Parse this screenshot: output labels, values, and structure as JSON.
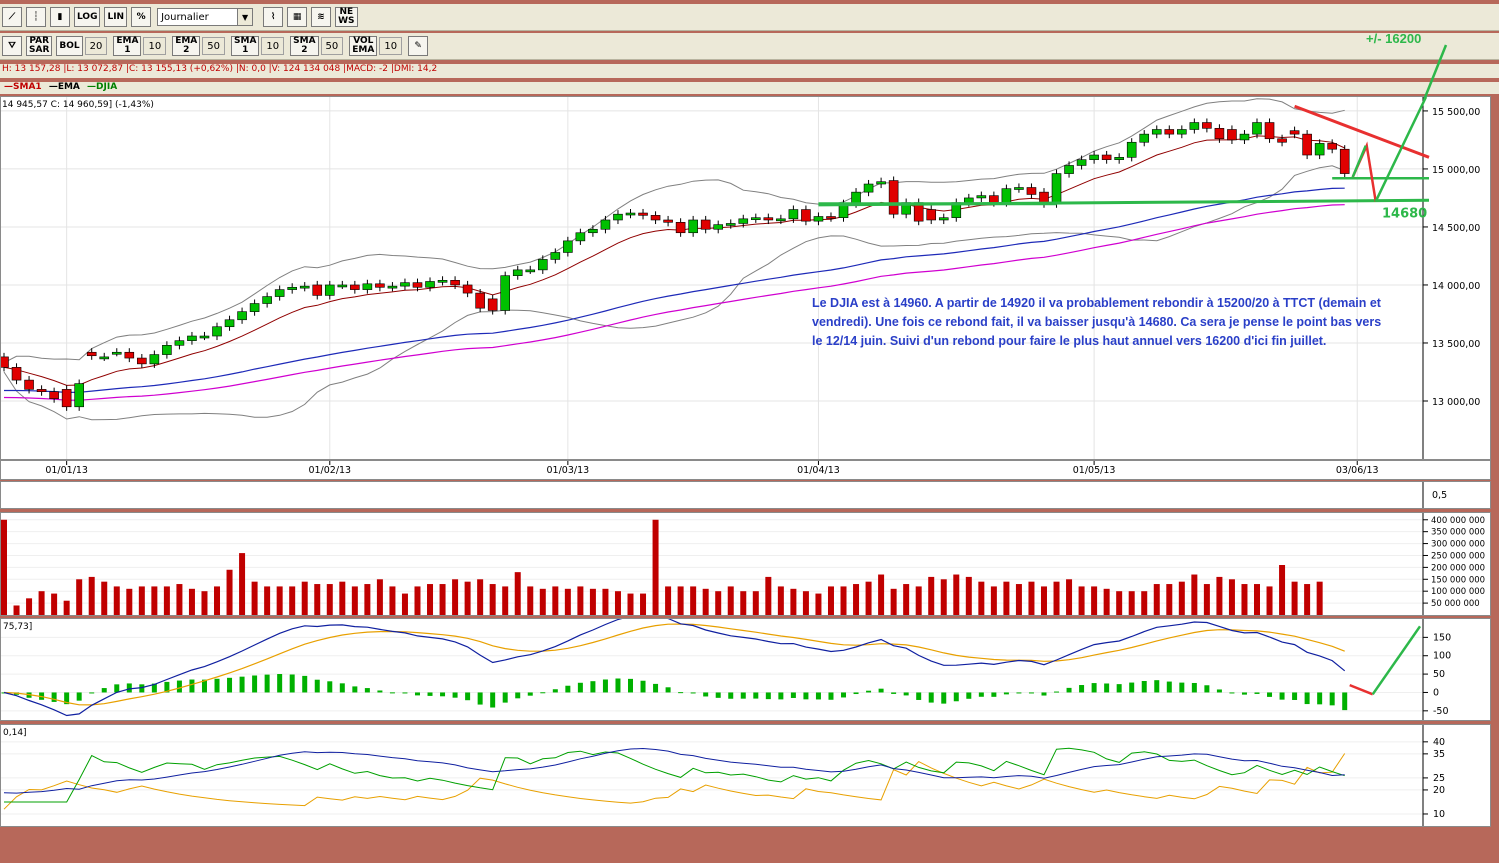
{
  "toolbar1": {
    "buttons": [
      {
        "name": "line-chart-icon",
        "label": ""
      },
      {
        "name": "bar-chart-icon",
        "label": ""
      },
      {
        "name": "candle-chart-icon",
        "label": ""
      },
      {
        "name": "log-button",
        "label": "LOG"
      },
      {
        "name": "lin-button",
        "label": "LIN"
      },
      {
        "name": "percent-button",
        "label": "%"
      }
    ],
    "period_select": "Journalier",
    "tools": [
      {
        "name": "studies-icon",
        "label": ""
      },
      {
        "name": "palette-icon",
        "label": ""
      },
      {
        "name": "compare-icon",
        "label": ""
      },
      {
        "name": "news-button",
        "label": "NE\nWS"
      }
    ]
  },
  "toolbar2": {
    "items": [
      {
        "name": "trash-icon",
        "label": "",
        "value": ""
      },
      {
        "name": "parsar-button",
        "label": "PAR\nSAR",
        "value": ""
      },
      {
        "name": "bol-button",
        "label": "BOL",
        "value": "20"
      },
      {
        "name": "ema1-button",
        "label": "EMA\n1",
        "value": "10"
      },
      {
        "name": "ema2-button",
        "label": "EMA\n2",
        "value": "50"
      },
      {
        "name": "sma1-button",
        "label": "SMA\n1",
        "value": "10"
      },
      {
        "name": "sma2-button",
        "label": "SMA\n2",
        "value": "50"
      },
      {
        "name": "volema-button",
        "label": "VOL\nEMA",
        "value": "10"
      },
      {
        "name": "drawing-icon",
        "label": "",
        "value": ""
      }
    ]
  },
  "infobar": "H: 13 157,28 |L: 13 072,87 |C: 13 155,13 (+0,62%) |N: 0,0 |V: 124 134 048 |MACD: -2 |DMI: 14,2",
  "legend": {
    "items": [
      {
        "label": "SMA1",
        "color": "#c00000"
      },
      {
        "label": "EMA",
        "color": "#000080"
      },
      {
        "label": "DJIA",
        "color": "#008000"
      }
    ],
    "sub": "14 945,57  C: 14 960,59] (-1,43%)"
  },
  "colors": {
    "up_candle": "#00c000",
    "down_candle": "#e00000",
    "bollinger": "#808080",
    "sma": "#900000",
    "ema_blue": "#1e2ab8",
    "ema_magenta": "#d000d0",
    "annotation_green": "#2db84a",
    "annotation_red": "#e83030",
    "annotation_text": "#2a3fc8",
    "volume": "#c00000",
    "macd_line": "#1020a0",
    "macd_signal": "#e8a000",
    "macd_hist": "#00b000",
    "dmi_blue": "#1020a0",
    "dmi_green": "#00a000",
    "dmi_orange": "#e8a000"
  },
  "annotation": {
    "text": "Le DJIA est à 14960. A partir de 14920 il va probablement rebondir à 15200/20 à TTCT (demain et vendredi). Une fois ce rebond fait, il va baisser jusqu'à 14680. Ca sera je pense le point bas vers le 12/14 juin. Suivi d'un rebond pour faire le plus haut annuel vers 16200 d'ici fin juillet.",
    "target_label": "+/- 16200",
    "support_label": "14680"
  },
  "chart_data": [
    {
      "type": "candlestick",
      "title": "DJIA",
      "x_ticks": [
        "01/01/13",
        "01/02/13",
        "01/03/13",
        "01/04/13",
        "01/05/13",
        "03/06/13"
      ],
      "y_ticks": [
        13000,
        13500,
        14000,
        14500,
        15000,
        15500
      ],
      "y_tick_labels": [
        "13 000,00",
        "13 500,00",
        "14 000,00",
        "14 500,00",
        "15 000,00",
        "15 500,00"
      ],
      "ylim": [
        12500,
        15620
      ],
      "close": [
        13290,
        13180,
        13100,
        13080,
        13020,
        12950,
        13150,
        13390,
        13380,
        13420,
        13370,
        13320,
        13400,
        13480,
        13520,
        13560,
        13560,
        13640,
        13700,
        13770,
        13840,
        13900,
        13960,
        13980,
        13990,
        13910,
        14000,
        14000,
        13960,
        14010,
        13980,
        13990,
        14020,
        13980,
        14030,
        14040,
        14000,
        13930,
        13800,
        13780,
        14080,
        14130,
        14130,
        14220,
        14280,
        14380,
        14450,
        14480,
        14560,
        14610,
        14620,
        14600,
        14560,
        14540,
        14450,
        14560,
        14480,
        14520,
        14530,
        14570,
        14580,
        14560,
        14570,
        14650,
        14550,
        14590,
        14580,
        14700,
        14800,
        14870,
        14890,
        14610,
        14710,
        14550,
        14560,
        14580,
        14710,
        14750,
        14770,
        14710,
        14830,
        14840,
        14780,
        14700,
        14960,
        15030,
        15080,
        15120,
        15080,
        15100,
        15230,
        15300,
        15340,
        15300,
        15340,
        15400,
        15350,
        15260,
        15250,
        15300,
        15400,
        15260,
        15230,
        15300,
        15120,
        15220,
        15170,
        14960
      ],
      "open": [
        13380,
        13290,
        13180,
        13100,
        13080,
        13100,
        12950,
        13420,
        13380,
        13420,
        13420,
        13370,
        13320,
        13400,
        13480,
        13520,
        13560,
        13560,
        13640,
        13700,
        13770,
        13840,
        13900,
        13960,
        13980,
        14000,
        13910,
        14000,
        14000,
        13960,
        14010,
        13980,
        13990,
        14020,
        13980,
        14030,
        14040,
        14000,
        13930,
        13880,
        13780,
        14080,
        14130,
        14130,
        14220,
        14280,
        14380,
        14450,
        14480,
        14560,
        14610,
        14620,
        14600,
        14560,
        14540,
        14450,
        14560,
        14480,
        14520,
        14530,
        14570,
        14580,
        14560,
        14570,
        14650,
        14550,
        14590,
        14580,
        14700,
        14800,
        14870,
        14900,
        14610,
        14710,
        14650,
        14560,
        14580,
        14710,
        14750,
        14770,
        14710,
        14830,
        14840,
        14800,
        14700,
        14960,
        15030,
        15080,
        15120,
        15080,
        15100,
        15230,
        15300,
        15340,
        15300,
        15340,
        15400,
        15350,
        15340,
        15250,
        15300,
        15400,
        15260,
        15330,
        15300,
        15120,
        15220,
        15170
      ],
      "series": [
        {
          "name": "SMA1"
        },
        {
          "name": "EMA"
        },
        {
          "name": "DJIA"
        }
      ]
    },
    {
      "type": "bar",
      "title": "Volume",
      "y_ticks": [
        50000000,
        100000000,
        150000000,
        200000000,
        250000000,
        300000000,
        350000000,
        400000000
      ],
      "y_tick_labels": [
        "50 000 000",
        "100 000 000",
        "150 000 000",
        "200 000 000",
        "250 000 000",
        "300 000 000",
        "350 000 000",
        "400 000 000"
      ],
      "ylim": [
        0,
        420000000
      ],
      "values": [
        400000000,
        40000000,
        70000000,
        100000000,
        90000000,
        60000000,
        150000000,
        160000000,
        140000000,
        120000000,
        110000000,
        120000000,
        120000000,
        120000000,
        130000000,
        110000000,
        100000000,
        120000000,
        190000000,
        260000000,
        140000000,
        120000000,
        120000000,
        120000000,
        140000000,
        130000000,
        130000000,
        140000000,
        120000000,
        130000000,
        150000000,
        120000000,
        90000000,
        120000000,
        130000000,
        130000000,
        150000000,
        140000000,
        150000000,
        130000000,
        120000000,
        180000000,
        120000000,
        110000000,
        120000000,
        110000000,
        120000000,
        110000000,
        110000000,
        100000000,
        90000000,
        90000000,
        400000000,
        120000000,
        120000000,
        120000000,
        110000000,
        100000000,
        120000000,
        100000000,
        100000000,
        160000000,
        120000000,
        110000000,
        100000000,
        90000000,
        120000000,
        120000000,
        130000000,
        140000000,
        170000000,
        110000000,
        130000000,
        120000000,
        160000000,
        150000000,
        170000000,
        160000000,
        140000000,
        120000000,
        140000000,
        130000000,
        140000000,
        120000000,
        140000000,
        150000000,
        120000000,
        120000000,
        110000000,
        100000000,
        100000000,
        100000000,
        130000000,
        130000000,
        140000000,
        170000000,
        130000000,
        160000000,
        150000000,
        130000000,
        130000000,
        120000000,
        210000000,
        140000000,
        130000000,
        140000000
      ],
      "side_tick": "0,5"
    },
    {
      "type": "line",
      "title": "MACD",
      "label": "75,73]",
      "y_ticks": [
        -50,
        0,
        50,
        100,
        150
      ],
      "ylim": [
        -75,
        200
      ]
    },
    {
      "type": "line",
      "title": "DMI",
      "label": "0,14]",
      "y_ticks": [
        10,
        20,
        25,
        35,
        40
      ],
      "ylim": [
        5,
        47
      ]
    }
  ]
}
